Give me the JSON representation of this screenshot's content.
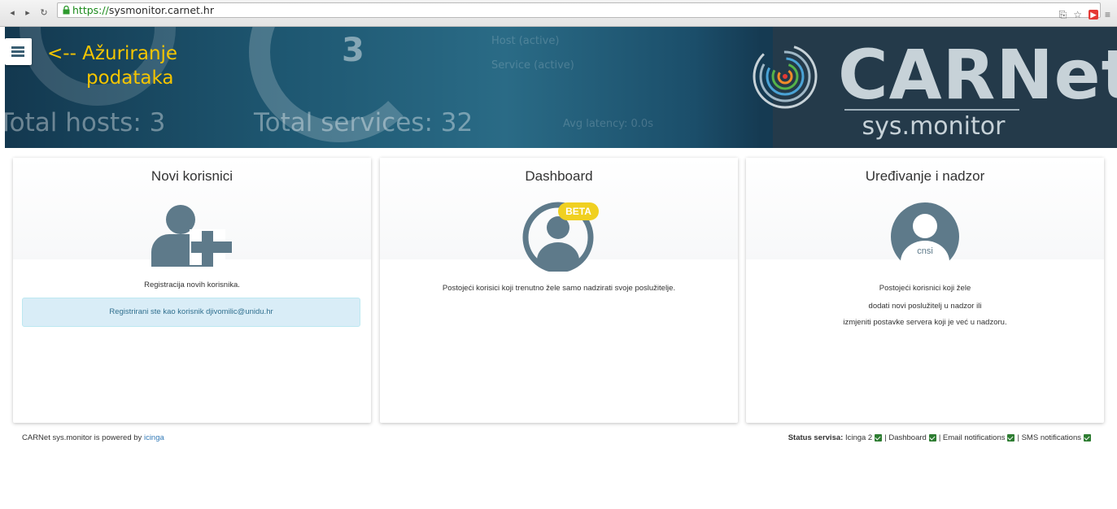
{
  "browser": {
    "url_scheme": "https://",
    "url_rest": "sysmonitor.carnet.hr"
  },
  "banner": {
    "stat_hosts_num": "3",
    "total_hosts": "Total hosts: 3",
    "total_services": "Total services: 32",
    "host_active": "Host (active)",
    "service_active": "Service (active)",
    "avg_latency": "Avg latency: 0.0s",
    "update_line1": "<-- Ažuriranje",
    "update_line2": "podataka",
    "logo_main": "CARNet",
    "logo_sub": "sys.monitor"
  },
  "cards": [
    {
      "title": "Novi korisnici",
      "text": "Registracija novih korisnika.",
      "alert": "Registrirani ste kao korisnik djivomilic@unidu.hr"
    },
    {
      "title": "Dashboard",
      "badge": "BETA",
      "text": "Postojeći korisici koji trenutno žele samo nadzirati svoje poslužitelje."
    },
    {
      "title": "Uređivanje i nadzor",
      "avatar_label": "cnsi",
      "lines": [
        "Postojeći korisnici koji žele",
        "dodati novi poslužitelj u nadzor ili",
        "izmjeniti postavke servera koji je već u nadzoru."
      ]
    }
  ],
  "footer": {
    "powered_prefix": "CARNet sys.monitor is powered by",
    "powered_link": "icinga",
    "status_label": "Status servisa:",
    "services": [
      "Icinga 2",
      "Dashboard",
      "Email notifications",
      "SMS notifications"
    ]
  },
  "colors": {
    "accent_yellow": "#f5c500",
    "icon_slate": "#5e7a8a",
    "alert_bg": "#d9edf7",
    "status_ok": "#2e7d32"
  }
}
